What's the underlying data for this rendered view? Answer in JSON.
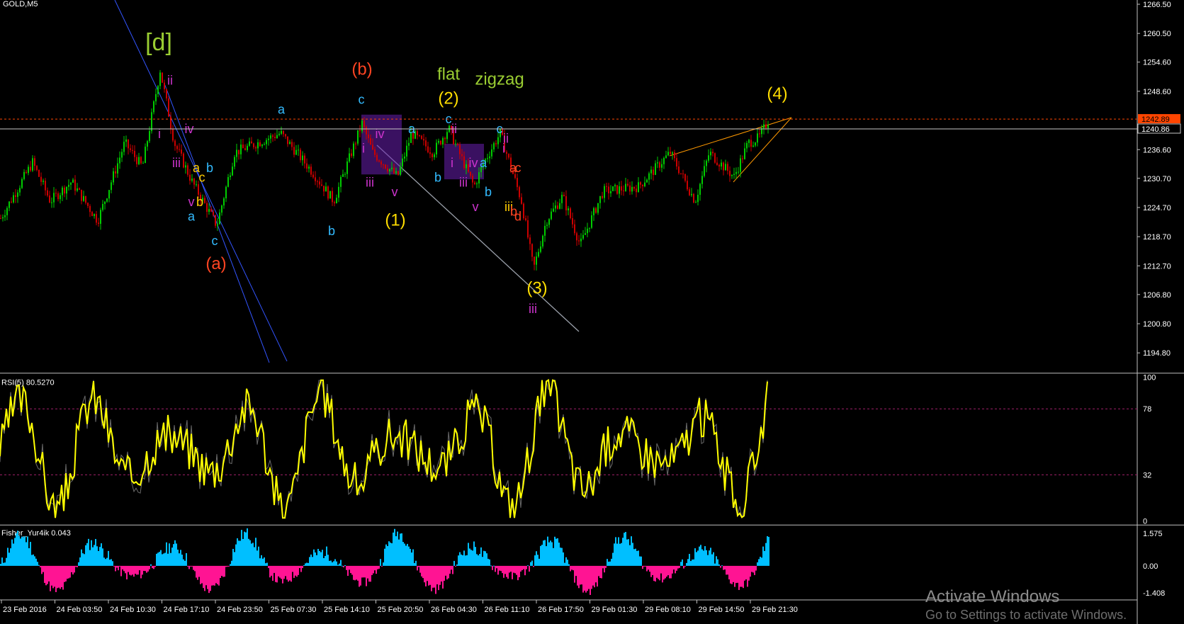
{
  "chart_data": {
    "type": "candlestick",
    "symbol_label": "GOLD,M5",
    "price_axis": {
      "ticks": [
        "1266.50",
        "1260.50",
        "1254.60",
        "1248.60",
        "1242.89",
        "1240.86",
        "1236.60",
        "1230.70",
        "1224.70",
        "1218.70",
        "1212.70",
        "1206.80",
        "1200.80",
        "1194.80"
      ],
      "ylim": [
        1191.5,
        1266.5
      ],
      "current_price": "1242.89",
      "crosshair_price": "1240.86"
    },
    "time_axis": {
      "labels": [
        "23 Feb 2016",
        "24 Feb 03:50",
        "24 Feb 10:30",
        "24 Feb 17:10",
        "24 Feb 23:50",
        "25 Feb 07:30",
        "25 Feb 14:10",
        "25 Feb 20:50",
        "26 Feb 04:30",
        "26 Feb 11:10",
        "26 Feb 17:50",
        "29 Feb 01:30",
        "29 Feb 08:10",
        "29 Feb 14:50",
        "29 Feb 21:30"
      ]
    },
    "price_path": [
      [
        0,
        1222.5
      ],
      [
        45,
        1234
      ],
      [
        70,
        1226
      ],
      [
        100,
        1230
      ],
      [
        137,
        1222
      ],
      [
        175,
        1238
      ],
      [
        200,
        1233
      ],
      [
        225,
        1253
      ],
      [
        245,
        1238
      ],
      [
        270,
        1230
      ],
      [
        305,
        1221
      ],
      [
        330,
        1236
      ],
      [
        395,
        1240
      ],
      [
        440,
        1232
      ],
      [
        470,
        1226
      ],
      [
        510,
        1242
      ],
      [
        525,
        1236
      ],
      [
        560,
        1231
      ],
      [
        580,
        1240
      ],
      [
        610,
        1236
      ],
      [
        632,
        1241
      ],
      [
        668,
        1229
      ],
      [
        682,
        1234
      ],
      [
        705,
        1240
      ],
      [
        735,
        1226
      ],
      [
        752,
        1212
      ],
      [
        770,
        1222
      ],
      [
        793,
        1227
      ],
      [
        818,
        1217
      ],
      [
        850,
        1228
      ],
      [
        900,
        1229
      ],
      [
        945,
        1236
      ],
      [
        980,
        1226
      ],
      [
        1000,
        1236
      ],
      [
        1035,
        1231
      ],
      [
        1055,
        1238
      ],
      [
        1070,
        1239
      ],
      [
        1085,
        1243
      ]
    ],
    "wave_labels": [
      {
        "text": "[d]",
        "x": 224,
        "price": 1257,
        "color": "#9acd32"
      },
      {
        "text": "ii",
        "x": 240,
        "price": 1250,
        "color": "#cc33cc"
      },
      {
        "text": "i",
        "x": 225,
        "price": 1239,
        "color": "#cc33cc"
      },
      {
        "text": "iv",
        "x": 267,
        "price": 1240,
        "color": "#cc33cc"
      },
      {
        "text": "iii",
        "x": 249,
        "price": 1233,
        "color": "#cc33cc"
      },
      {
        "text": "a",
        "x": 277,
        "price": 1232,
        "color": "#ffcc00"
      },
      {
        "text": "b",
        "x": 296,
        "price": 1232,
        "color": "#33bbff"
      },
      {
        "text": "c",
        "x": 285,
        "price": 1230,
        "color": "#ffcc00"
      },
      {
        "text": "v",
        "x": 270,
        "price": 1225,
        "color": "#cc33cc"
      },
      {
        "text": "b",
        "x": 282,
        "price": 1225,
        "color": "#ffcc00"
      },
      {
        "text": "a",
        "x": 270,
        "price": 1222,
        "color": "#33bbff"
      },
      {
        "text": "c",
        "x": 303,
        "price": 1217,
        "color": "#33bbff"
      },
      {
        "text": "(a)",
        "x": 305,
        "price": 1212,
        "color": "#ff4422"
      },
      {
        "text": "a",
        "x": 397,
        "price": 1244,
        "color": "#33bbff"
      },
      {
        "text": "b",
        "x": 468,
        "price": 1219,
        "color": "#33bbff"
      },
      {
        "text": "(b)",
        "x": 511,
        "price": 1252,
        "color": "#ff4422"
      },
      {
        "text": "c",
        "x": 510,
        "price": 1246,
        "color": "#33bbff"
      },
      {
        "text": "iv",
        "x": 536,
        "price": 1239,
        "color": "#cc33cc"
      },
      {
        "text": "i",
        "x": 513,
        "price": 1236,
        "color": "#cc33cc"
      },
      {
        "text": "iii",
        "x": 522,
        "price": 1229,
        "color": "#cc33cc"
      },
      {
        "text": "v",
        "x": 557,
        "price": 1227,
        "color": "#cc33cc"
      },
      {
        "text": "(1)",
        "x": 558,
        "price": 1221,
        "color": "#ffdd00"
      },
      {
        "text": "a",
        "x": 581,
        "price": 1240,
        "color": "#33bbff"
      },
      {
        "text": "flat",
        "x": 633,
        "price": 1251,
        "color": "#9acd32"
      },
      {
        "text": "zigzag",
        "x": 705,
        "price": 1250,
        "color": "#9acd32"
      },
      {
        "text": "(2)",
        "x": 633,
        "price": 1246,
        "color": "#ffdd00"
      },
      {
        "text": "c",
        "x": 633,
        "price": 1242,
        "color": "#33bbff"
      },
      {
        "text": "ii",
        "x": 641,
        "price": 1240,
        "color": "#cc33cc"
      },
      {
        "text": "i",
        "x": 638,
        "price": 1233,
        "color": "#cc33cc"
      },
      {
        "text": "b",
        "x": 618,
        "price": 1230,
        "color": "#33bbff"
      },
      {
        "text": "iii",
        "x": 654,
        "price": 1229,
        "color": "#cc33cc"
      },
      {
        "text": "iv",
        "x": 668,
        "price": 1233,
        "color": "#cc33cc"
      },
      {
        "text": "a",
        "x": 682,
        "price": 1233,
        "color": "#33bbff"
      },
      {
        "text": "v",
        "x": 671,
        "price": 1224,
        "color": "#cc33cc"
      },
      {
        "text": "b",
        "x": 689,
        "price": 1227,
        "color": "#33bbff"
      },
      {
        "text": "c",
        "x": 705,
        "price": 1240,
        "color": "#33bbff"
      },
      {
        "text": "ii",
        "x": 714,
        "price": 1238,
        "color": "#cc33cc"
      },
      {
        "text": "i",
        "x": 711,
        "price": 1236,
        "color": "#cc33cc"
      },
      {
        "text": "a",
        "x": 724,
        "price": 1232,
        "color": "#ff4422"
      },
      {
        "text": "c",
        "x": 731,
        "price": 1232,
        "color": "#ff4422"
      },
      {
        "text": "iii",
        "x": 718,
        "price": 1224,
        "color": "#ffcc00"
      },
      {
        "text": "b",
        "x": 725,
        "price": 1223,
        "color": "#ff4422"
      },
      {
        "text": "d",
        "x": 731,
        "price": 1222,
        "color": "#ff4422"
      },
      {
        "text": "(3)",
        "x": 758,
        "price": 1207,
        "color": "#ffdd00"
      },
      {
        "text": "iii",
        "x": 752,
        "price": 1203,
        "color": "#cc33cc"
      },
      {
        "text": "(4)",
        "x": 1097,
        "price": 1247,
        "color": "#ffdd00"
      }
    ],
    "boxes": [
      [
        510,
        567,
        1243.8,
        1231.5
      ],
      [
        627,
        683,
        1237.8,
        1230.5
      ]
    ],
    "rsi": {
      "label": "RSI(5) 80.5270",
      "ticks": [
        "100",
        "78",
        "32",
        "0"
      ],
      "levels": [
        78,
        32
      ]
    },
    "fisher": {
      "label": "Fisher_Yur4ik 0.043",
      "ticks": [
        "1.575",
        "0.00",
        "-1.408"
      ]
    },
    "colors": {
      "up_candle": "#00cc00",
      "down_candle": "#cc0000",
      "rsi_line": "#ffff00",
      "fisher_pos": "#00bfff",
      "fisher_neg": "#ff1493",
      "current_line": "#ff4500"
    }
  },
  "watermark": {
    "line1": "Activate Windows",
    "line2": "Go to Settings to activate Windows."
  }
}
